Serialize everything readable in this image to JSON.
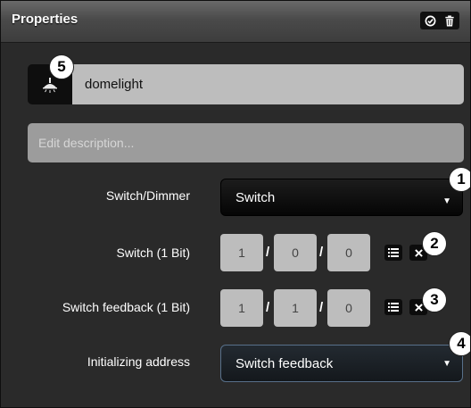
{
  "header": {
    "title": "Properties",
    "buttons": [
      {
        "icon": "check-circle-icon"
      },
      {
        "icon": "trash-icon"
      }
    ]
  },
  "object": {
    "icon": "ceiling-light-icon",
    "name": "domelight"
  },
  "description": {
    "placeholder": "Edit description..."
  },
  "fields": {
    "switch_dimmer": {
      "label": "Switch/Dimmer",
      "value": "Switch"
    },
    "switch": {
      "label": "Switch (1 Bit)",
      "address": [
        "1",
        "0",
        "0"
      ]
    },
    "switch_feedback": {
      "label": "Switch feedback (1 Bit)",
      "address": [
        "1",
        "1",
        "0"
      ]
    },
    "initializing": {
      "label": "Initializing address",
      "value": "Switch feedback"
    }
  },
  "badges": [
    "1",
    "2",
    "3",
    "4",
    "5"
  ],
  "colors": {
    "panel_bg": "#2a2a2a",
    "header_bg": "#555555",
    "input_bg": "#bdbdbd",
    "select_outline": "#58708a"
  }
}
